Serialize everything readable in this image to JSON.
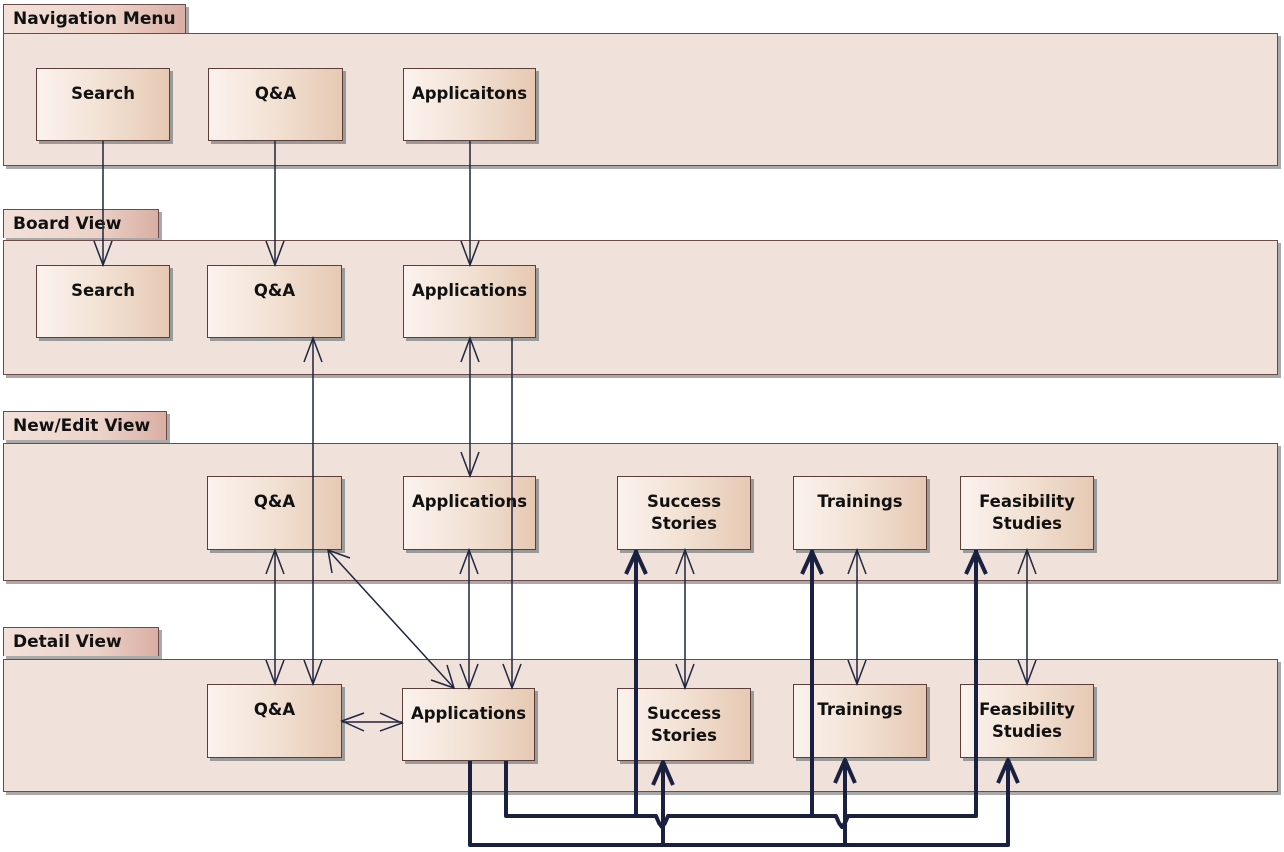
{
  "packages": [
    {
      "id": "nav",
      "label": "Navigation Menu"
    },
    {
      "id": "board",
      "label": "Board View"
    },
    {
      "id": "edit",
      "label": "New/Edit View"
    },
    {
      "id": "detail",
      "label": "Detail View"
    }
  ],
  "nodes": {
    "nav_search": "Search",
    "nav_qa": "Q&A",
    "nav_apps": "Applicaitons",
    "board_search": "Search",
    "board_qa": "Q&A",
    "board_apps": "Applications",
    "edit_qa": "Q&A",
    "edit_apps": "Applications",
    "edit_success": "Success Stories",
    "edit_trainings": "Trainings",
    "edit_feasibility": "Feasibility Studies",
    "detail_qa": "Q&A",
    "detail_apps": "Applications",
    "detail_success": "Success Stories",
    "detail_trainings": "Trainings",
    "detail_feasibility": "Feasibility Studies"
  },
  "connections": [
    {
      "from": "nav_search",
      "to": "board_search",
      "type": "directed"
    },
    {
      "from": "nav_qa",
      "to": "board_qa",
      "type": "directed"
    },
    {
      "from": "nav_apps",
      "to": "board_apps",
      "type": "directed"
    },
    {
      "from": "board_qa",
      "to": "detail_qa",
      "type": "bidirectional"
    },
    {
      "from": "board_apps",
      "to": "edit_apps",
      "type": "bidirectional"
    },
    {
      "from": "board_apps",
      "to": "detail_apps",
      "type": "directed"
    },
    {
      "from": "edit_qa",
      "to": "detail_qa",
      "type": "bidirectional"
    },
    {
      "from": "edit_qa",
      "to": "detail_apps",
      "type": "bidirectional"
    },
    {
      "from": "edit_apps",
      "to": "detail_apps",
      "type": "bidirectional"
    },
    {
      "from": "detail_qa",
      "to": "detail_apps",
      "type": "bidirectional"
    },
    {
      "from": "edit_success",
      "to": "detail_success",
      "type": "bidirectional"
    },
    {
      "from": "edit_trainings",
      "to": "detail_trainings",
      "type": "bidirectional"
    },
    {
      "from": "edit_feasibility",
      "to": "detail_feasibility",
      "type": "bidirectional"
    },
    {
      "from": "detail_apps",
      "to": "edit_success",
      "type": "thick"
    },
    {
      "from": "detail_apps",
      "to": "edit_trainings",
      "type": "thick"
    },
    {
      "from": "detail_apps",
      "to": "edit_feasibility",
      "type": "thick"
    },
    {
      "from": "detail_apps",
      "to": "detail_success",
      "type": "thick"
    },
    {
      "from": "detail_apps",
      "to": "detail_trainings",
      "type": "thick"
    },
    {
      "from": "detail_apps",
      "to": "detail_feasibility",
      "type": "thick"
    }
  ],
  "colors": {
    "line": "#1e2640",
    "package_fill": "#f0e1da",
    "border": "#6b4a48"
  }
}
